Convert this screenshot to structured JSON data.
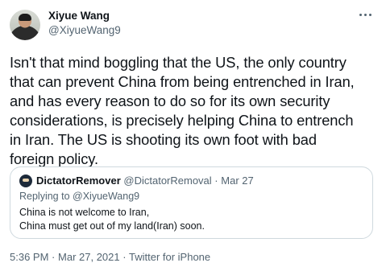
{
  "author": {
    "name": "Xiyue Wang",
    "handle": "@XiyueWang9"
  },
  "more_icon": "more-horizontal-icon",
  "text_lines": [
    "Isn't that mind boggling that the US, the only country",
    "that can prevent China from being entrenched in Iran,",
    "and has every reason to do so for its own security",
    "considerations, is precisely helping China to entrench",
    "in Iran. The US is shooting its own foot with bad",
    "foreign policy."
  ],
  "quote": {
    "name": "DictatorRemover",
    "handle": "@DictatorRemoval",
    "separator": "·",
    "date": "Mar 27",
    "replying_to": "Replying to @XiyueWang9",
    "lines": [
      "China is not welcome to Iran,",
      "China must get out of my land(Iran) soon."
    ]
  },
  "meta": {
    "time": "5:36 PM",
    "separator": "·",
    "date": "Mar 27, 2021",
    "source": "Twitter for iPhone"
  },
  "colors": {
    "text": "#0f1419",
    "secondary": "#536471",
    "border": "#cfd9de"
  }
}
